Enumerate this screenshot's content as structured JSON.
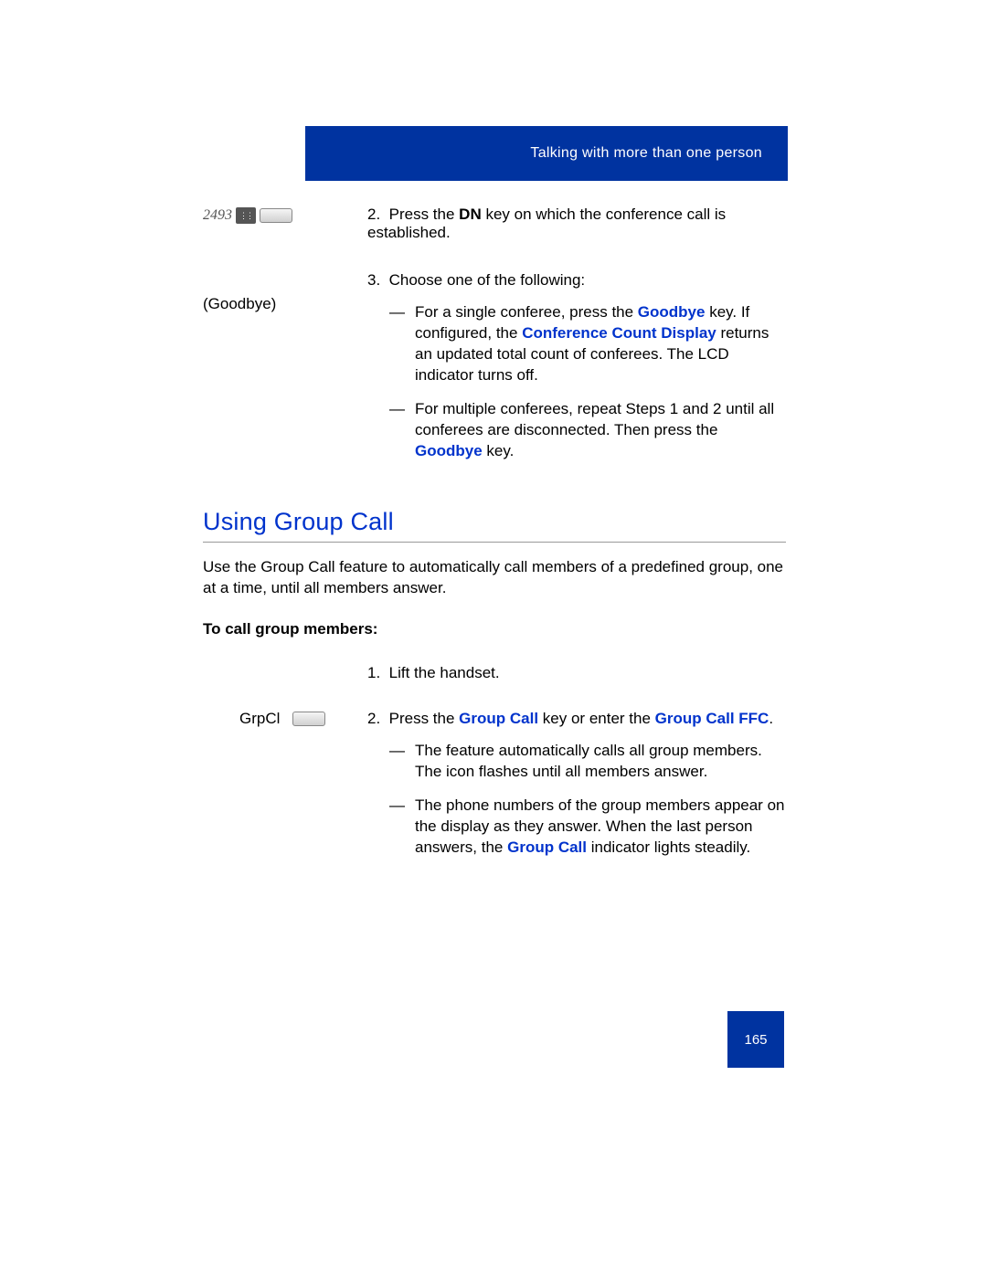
{
  "header": {
    "title": "Talking with more than one person"
  },
  "section_top": {
    "dn_key_label": "2493",
    "goodbye_label": "(Goodbye)",
    "step2_a": "Press the ",
    "step2_bold": "DN",
    "step2_b": " key on which the conference call is established.",
    "step3": "Choose one of the following:",
    "sub3a_a": "For a single conferee, press the ",
    "sub3a_goodbye": "Goodbye",
    "sub3a_b": " key. If configured, the ",
    "sub3a_ccd": "Conference Count Display",
    "sub3a_c": " returns an updated total count of conferees. The LCD indicator turns off.",
    "sub3b_a": "For multiple conferees, repeat Steps 1 and 2 until all conferees are disconnected. Then press the ",
    "sub3b_goodbye": "Goodbye",
    "sub3b_b": " key."
  },
  "section_group": {
    "title": "Using Group Call",
    "intro": "Use the Group Call feature to automatically call members of a predefined group, one at a time, until all members answer.",
    "subhead": "To call group members:",
    "step1": "Lift the handset.",
    "grpcl_label": "GrpCl",
    "step2_a": "Press the ",
    "step2_gc": "Group Call",
    "step2_b": " key or enter the ",
    "step2_ffc": "Group Call FFC",
    "step2_c": ".",
    "sub2a": "The feature automatically calls all group members. The icon flashes until all members answer.",
    "sub2b_a": "The phone numbers of the group members appear on the display as they answer. When the last person answers, the ",
    "sub2b_gc": "Group Call",
    "sub2b_b": " indicator lights steadily."
  },
  "footer": {
    "page": "165"
  }
}
